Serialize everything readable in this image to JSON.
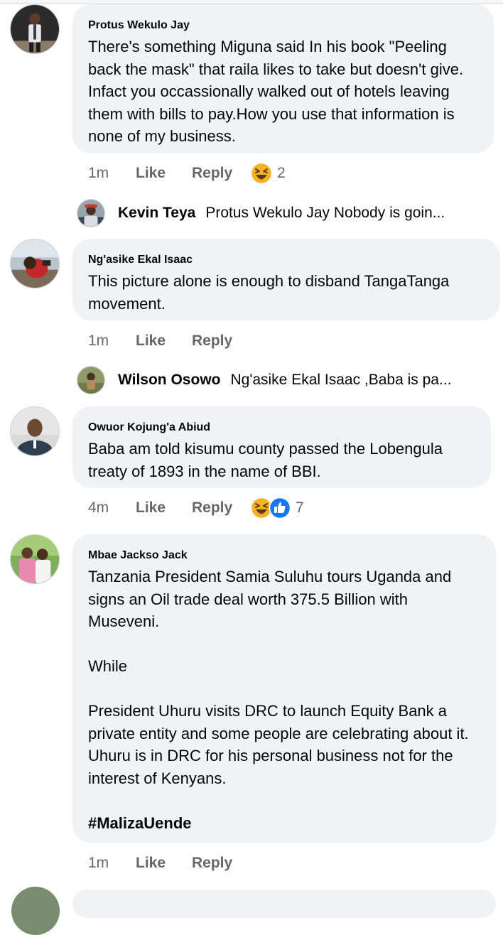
{
  "comments": [
    {
      "author": "Protus Wekulo Jay",
      "paragraphs": [
        "There's something Miguna said In his book \"Peeling back the mask\" that raila likes to take but doesn't give. Infact you occassionally walked out of hotels leaving them with bills to pay.How you use that information is none of my business."
      ],
      "time": "1m",
      "like_label": "Like",
      "reply_label": "Reply",
      "reaction_icons": [
        "haha-emoji-icon"
      ],
      "reaction_count": "2",
      "reply_preview": {
        "name": "Kevin Teya",
        "snippet": "Protus Wekulo Jay Nobody is goin..."
      }
    },
    {
      "author": "Ng'asike Ekal Isaac",
      "paragraphs": [
        "This picture alone is enough to disband TangaTanga movement."
      ],
      "time": "1m",
      "like_label": "Like",
      "reply_label": "Reply",
      "reply_preview": {
        "name": "Wilson Osowo",
        "snippet": "Ng'asike Ekal Isaac ,Baba is pa..."
      }
    },
    {
      "author": "Owuor Kojung'a Abiud",
      "paragraphs": [
        "Baba am told kisumu county passed the Lobengula treaty of 1893 in the name of BBI."
      ],
      "time": "4m",
      "like_label": "Like",
      "reply_label": "Reply",
      "reaction_icons": [
        "haha-emoji-icon",
        "like-thumb-icon"
      ],
      "reaction_count": "7"
    },
    {
      "author": "Mbae Jackso Jack",
      "paragraphs": [
        "Tanzania President Samia Suluhu tours Uganda and signs an Oil trade deal worth 375.5 Billion with Museveni.",
        "While",
        "President Uhuru visits DRC to launch Equity Bank a private entity and some people are celebrating about it. Uhuru is in DRC for his personal business not for the interest of Kenyans."
      ],
      "hashtag": "#MalizaUende",
      "time": "1m",
      "like_label": "Like",
      "reply_label": "Reply"
    }
  ],
  "colors": {
    "bubble_bg": "#f0f2f5",
    "meta_text": "#65676b",
    "like_blue": "#1877f2",
    "haha_yellow": "#f7b125"
  }
}
